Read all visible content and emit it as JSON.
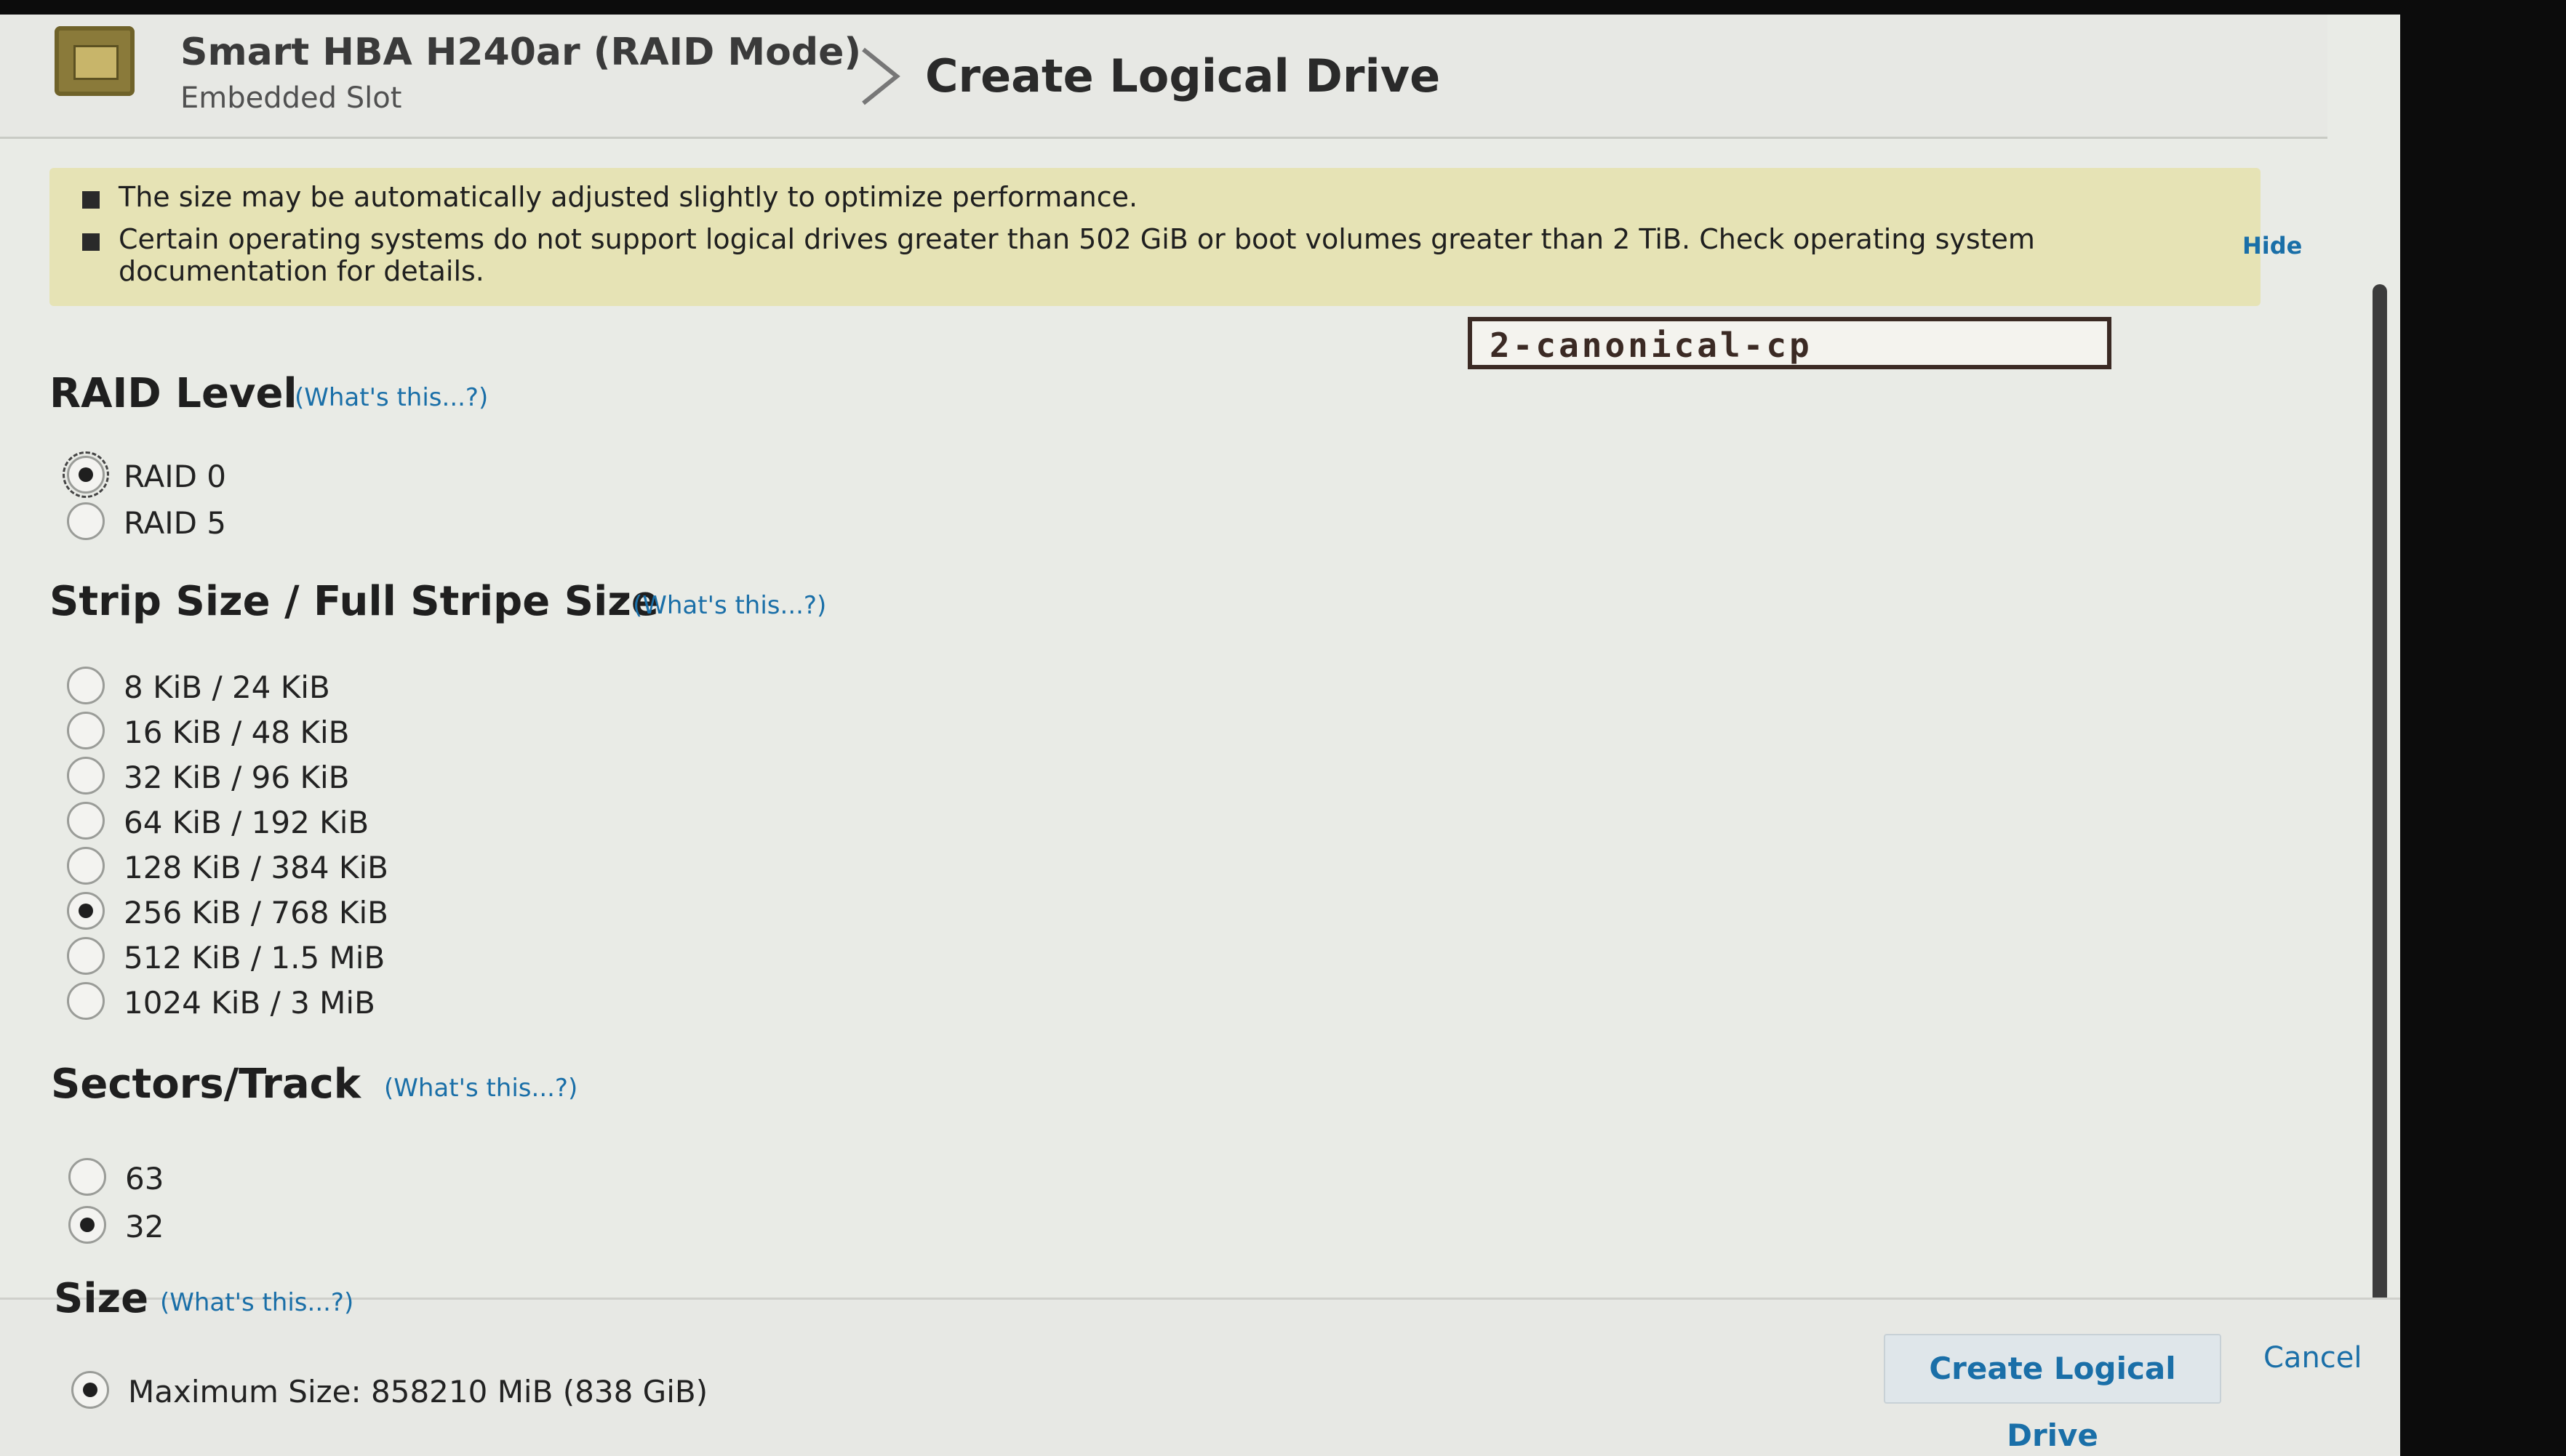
{
  "header": {
    "device_title": "Smart HBA H240ar (RAID Mode)",
    "slot": "Embedded Slot",
    "page_title": "Create Logical Drive"
  },
  "alert": {
    "lines": [
      "The size may be automatically adjusted slightly to optimize performance.",
      "Certain operating systems do not support logical drives greater than 502 GiB or boot volumes greater than 2 TiB. Check operating system",
      "documentation for details."
    ],
    "hide_label": "Hide"
  },
  "label_sticker": "2-canonical-cp",
  "raid_level": {
    "title": "RAID Level",
    "help": "(What's this...?)",
    "options": [
      "RAID 0",
      "RAID 5"
    ],
    "selected": "RAID 0"
  },
  "strip_size": {
    "title": "Strip Size / Full Stripe Size",
    "help": "(What's this...?)",
    "options": [
      "8 KiB / 24 KiB",
      "16 KiB / 48 KiB",
      "32 KiB / 96 KiB",
      "64 KiB / 192 KiB",
      "128 KiB / 384 KiB",
      "256 KiB / 768 KiB",
      "512 KiB / 1.5 MiB",
      "1024 KiB / 3 MiB"
    ],
    "selected": "256 KiB / 768 KiB"
  },
  "sectors_track": {
    "title": "Sectors/Track",
    "help": "(What's this...?)",
    "options": [
      "63",
      "32"
    ],
    "selected": "32"
  },
  "size": {
    "title": "Size",
    "help": "(What's this...?)",
    "option": "Maximum Size: 858210 MiB (838 GiB)"
  },
  "footer": {
    "create_label": "Create Logical Drive",
    "cancel_label": "Cancel"
  },
  "colors": {
    "link": "#1a6fa8",
    "alert_bg": "#e6e3b5",
    "background": "#e9ebe6"
  }
}
